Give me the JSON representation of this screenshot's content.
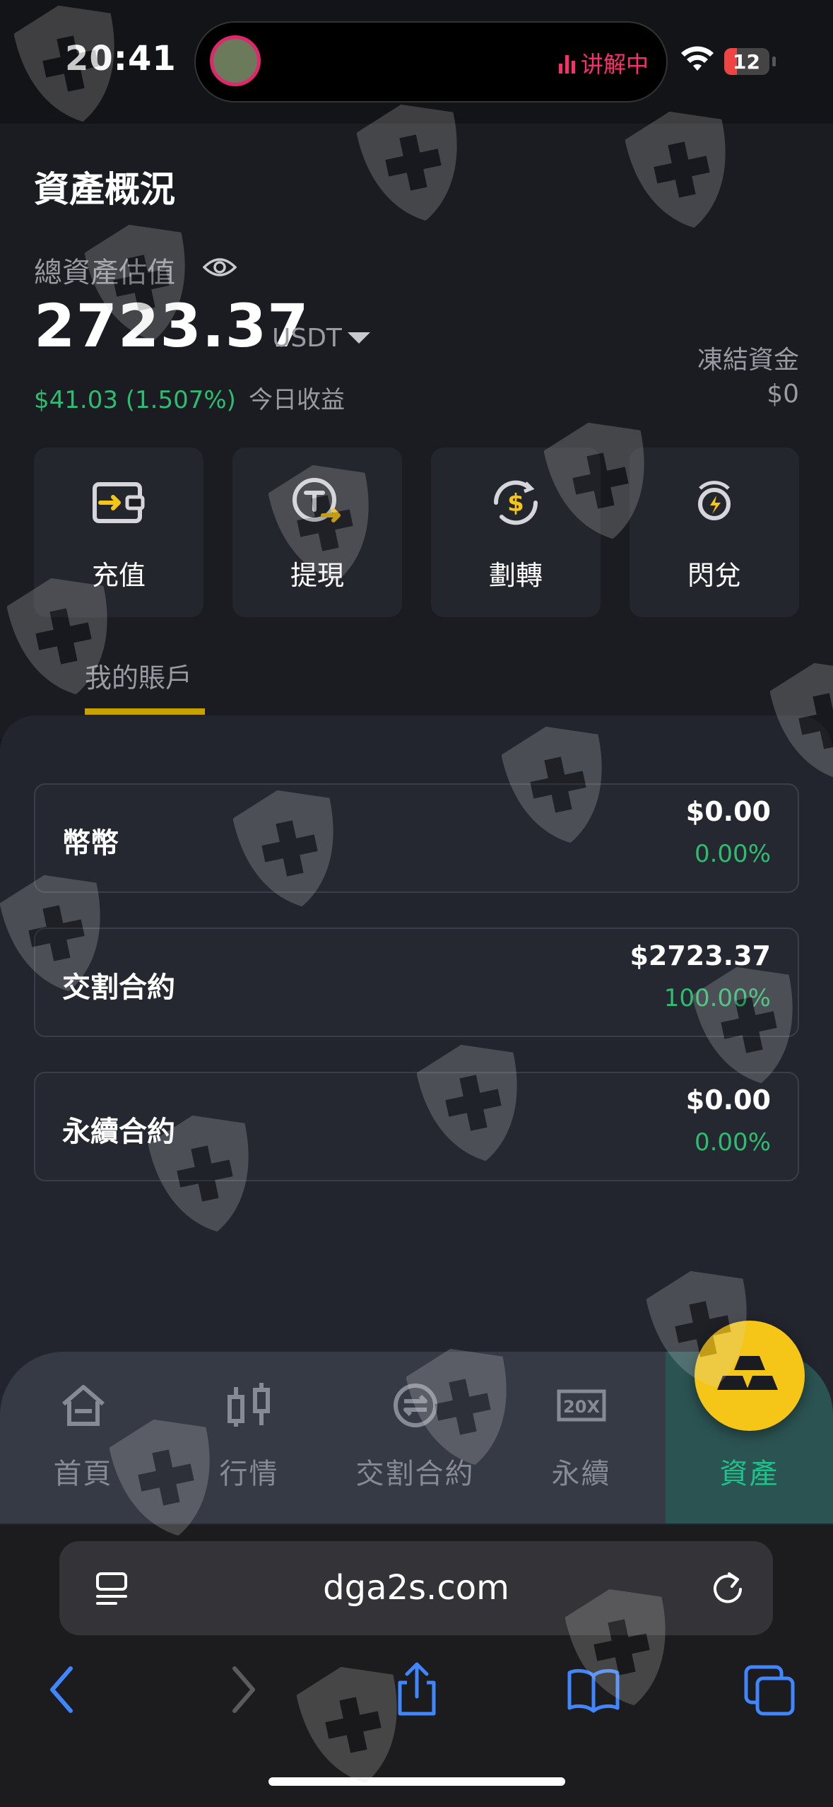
{
  "status": {
    "time": "20:41",
    "live_label": "讲解中",
    "battery": "12"
  },
  "assets": {
    "title": "資產概況",
    "total_label": "總資產估值",
    "balance": "2723.37",
    "currency": "USDT",
    "today_profit": "$41.03 (1.507%)",
    "today_label": "今日收益",
    "frozen_label": "凍結資金",
    "frozen_value": "$0"
  },
  "actions": [
    {
      "label": "充值",
      "icon": "wallet-deposit-icon"
    },
    {
      "label": "提現",
      "icon": "tether-withdraw-icon"
    },
    {
      "label": "劃轉",
      "icon": "dollar-transfer-icon"
    },
    {
      "label": "閃兌",
      "icon": "flash-exchange-icon"
    }
  ],
  "tabs": {
    "my_accounts": "我的賬戶"
  },
  "accounts": [
    {
      "name": "幣幣",
      "value": "$0.00",
      "percent": "0.00%"
    },
    {
      "name": "交割合約",
      "value": "$2723.37",
      "percent": "100.00%"
    },
    {
      "name": "永續合約",
      "value": "$0.00",
      "percent": "0.00%"
    }
  ],
  "nav": [
    {
      "label": "首頁",
      "icon": "home-icon"
    },
    {
      "label": "行情",
      "icon": "candlestick-icon"
    },
    {
      "label": "交割合約",
      "icon": "swap-circle-icon"
    },
    {
      "label": "永續",
      "icon": "20x-leverage-icon"
    },
    {
      "label": "資產",
      "icon": "gold-bars-icon"
    }
  ],
  "browser": {
    "url": "dga2s.com"
  },
  "colors": {
    "accent_gold": "#f5c518",
    "positive_green": "#2ebd6f",
    "active_teal": "#1ec28b"
  }
}
